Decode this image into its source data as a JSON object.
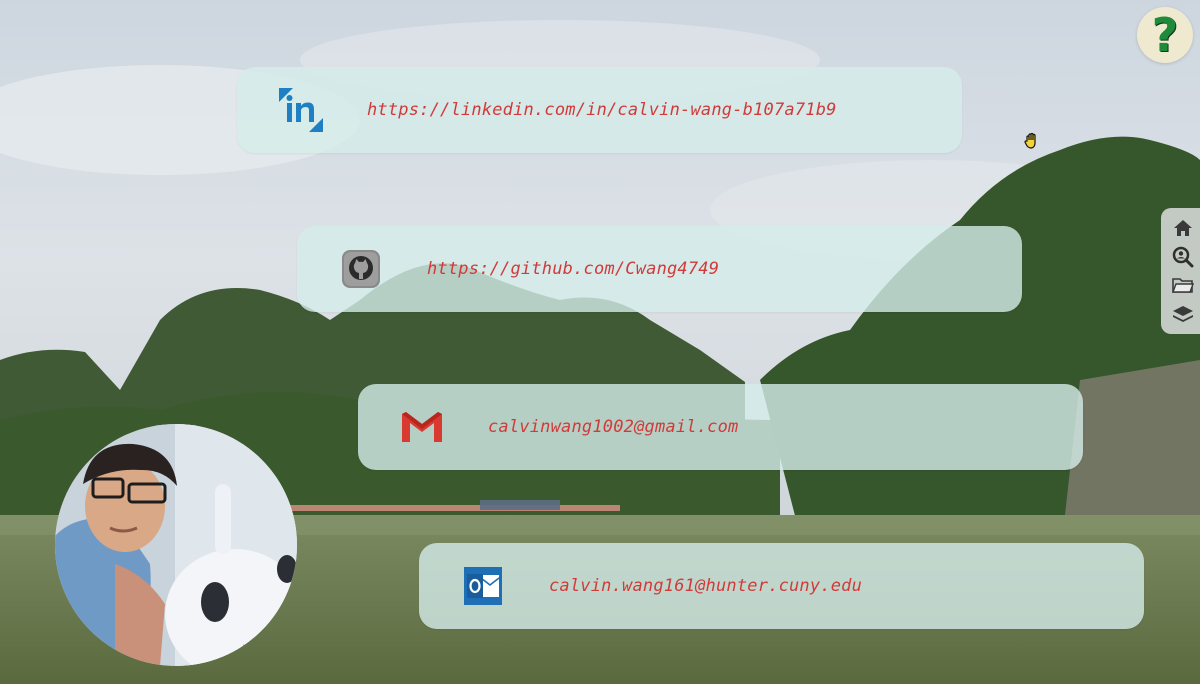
{
  "contacts": [
    {
      "id": "linkedin",
      "label": "https://linkedin.com/in/calvin-wang-b107a71b9",
      "icon": "linkedin-icon"
    },
    {
      "id": "github",
      "label": "https://github.com/Cwang4749",
      "icon": "github-icon"
    },
    {
      "id": "gmail",
      "label": "calvinwang1002@gmail.com",
      "icon": "gmail-icon"
    },
    {
      "id": "outlook",
      "label": "calvin.wang161@hunter.cuny.edu",
      "icon": "outlook-icon"
    }
  ],
  "help": {
    "label": "?",
    "icon": "question-mark-icon"
  },
  "sidenav": [
    {
      "icon": "home-icon"
    },
    {
      "icon": "search-user-icon"
    },
    {
      "icon": "folder-icon"
    },
    {
      "icon": "layers-icon"
    }
  ],
  "colors": {
    "link_text": "#d23a3a",
    "card_bg": "#d5ecea",
    "help_bg": "#efe9cf",
    "help_fg": "#1e8a3a"
  }
}
